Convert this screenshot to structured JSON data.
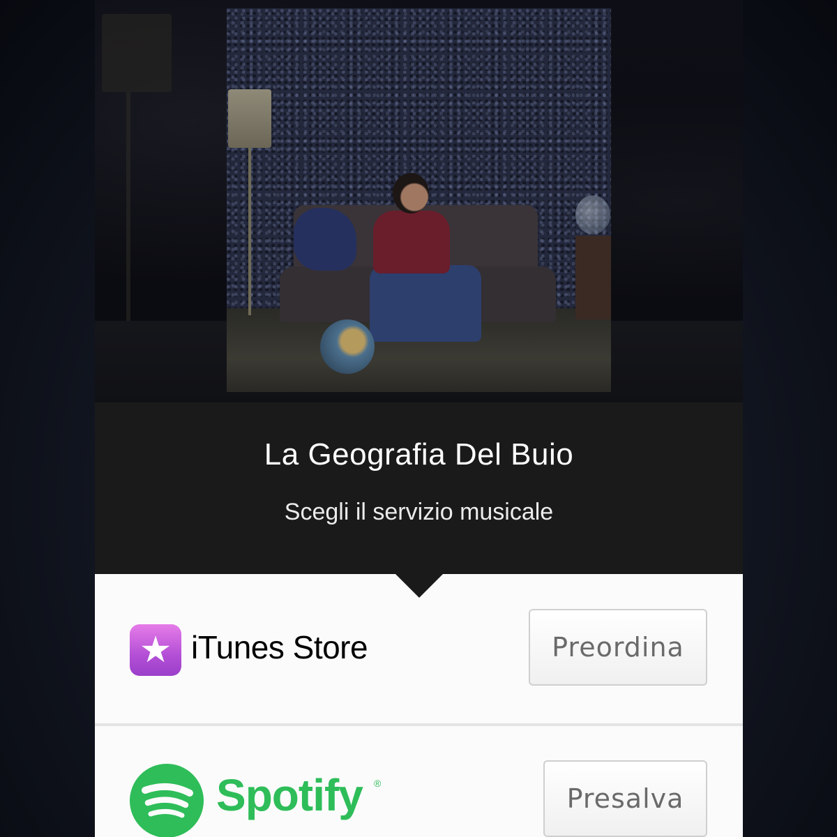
{
  "album": {
    "title": "La Geografia Del Buio",
    "subtitle": "Scegli il servizio musicale"
  },
  "services": [
    {
      "name": "iTunes Store",
      "icon": "itunes-store-icon",
      "action_label": "Preordina",
      "icon_glyph": "★"
    },
    {
      "name": "Spotify",
      "icon": "spotify-logo-icon",
      "action_label": "Presalva",
      "trademark": "®"
    }
  ],
  "colors": {
    "title_band": "#1a1a1a",
    "list_background": "#fbfbfb",
    "itunes_gradient_top": "#e67ce8",
    "itunes_gradient_bottom": "#9b3fca",
    "spotify_green": "#2ebd59",
    "button_text": "#6a6a6a"
  }
}
